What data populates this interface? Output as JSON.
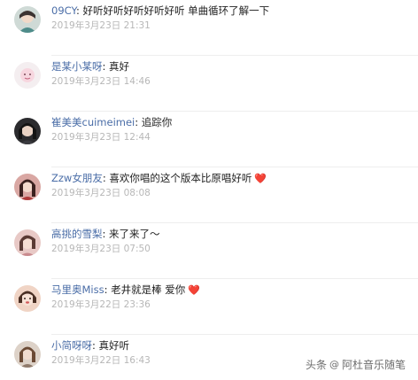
{
  "comments": [
    {
      "username": "09CY",
      "text": "好听好听好听好听好听 单曲循环了解一下",
      "time": "2019年3月23日 21:31",
      "avatar": "avatar-girl-teal"
    },
    {
      "username": "是某小某呀",
      "text": "真好",
      "time": "2019年3月23日 14:46",
      "avatar": "avatar-cartoon-pink"
    },
    {
      "username": "崔美美cuimeimei",
      "text": "追踪你",
      "time": "2019年3月23日 12:44",
      "avatar": "avatar-girl-dark"
    },
    {
      "username": "Zzw女朋友",
      "text": "喜欢你唱的这个版本比原唱好听",
      "time": "2019年3月23日 08:08",
      "avatar": "avatar-girl-red",
      "heart": "❤️"
    },
    {
      "username": "高挑的雪梨",
      "text": "来了来了～",
      "time": "2019年3月23日 07:50",
      "avatar": "avatar-girl-pink"
    },
    {
      "username": "马里奥Miss",
      "text": "老井就是棒 爱你",
      "time": "2019年3月22日 23:36",
      "avatar": "avatar-girl-warm",
      "heart": "❤️"
    },
    {
      "username": "小简呀呀",
      "text": "真好听",
      "time": "2019年3月22日 16:43",
      "avatar": "avatar-girl-brown"
    }
  ],
  "separator": ":",
  "watermark": {
    "prefix": "头条",
    "at": "@",
    "author": "阿杜音乐随笔"
  },
  "colors": {
    "username": "#4a6da7",
    "time": "#b7b7b7",
    "text": "#222222",
    "heart": "#e53935"
  }
}
